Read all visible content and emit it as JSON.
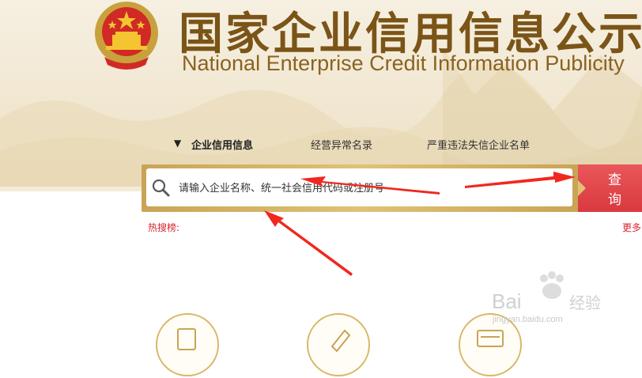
{
  "header": {
    "title_cn": "国家企业信用信息公示",
    "title_en": "National Enterprise Credit Information Publicity"
  },
  "tabs": [
    {
      "label": "企业信用信息",
      "active": true
    },
    {
      "label": "经营异常名录",
      "active": false
    },
    {
      "label": "严重违法失信企业名单",
      "active": false
    }
  ],
  "search": {
    "placeholder": "请输入企业名称、统一社会信用代码或注册号",
    "button_label": "查询"
  },
  "hot_search": {
    "label": "热搜榜:",
    "more_label": "更多"
  },
  "watermark": {
    "text": "jingyan.baidu.com"
  },
  "colors": {
    "title": "#7b5417",
    "search_frame": "#d4b061",
    "search_button": "#e04a4e",
    "hot_label": "#d6262c"
  }
}
